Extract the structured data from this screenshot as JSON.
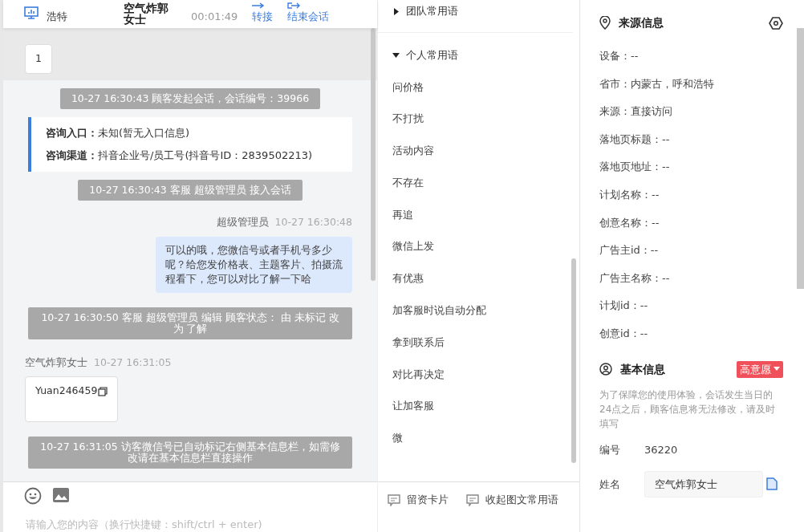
{
  "chat_header": {
    "location": "浩特",
    "customer_name": "空气炸郭女士",
    "duration": "00:01:49",
    "actions": [
      {
        "kind": "transfer",
        "label": "转接"
      },
      {
        "kind": "end",
        "label": "结束会话"
      }
    ]
  },
  "messages": [
    {
      "kind": "customer",
      "text": "1",
      "highlighted": true,
      "copyable": false
    },
    {
      "kind": "system",
      "text": "10-27 16:30:43 顾客发起会话，会话编号：39966"
    },
    {
      "kind": "entry",
      "lines": [
        {
          "label": "咨询入口：",
          "value": "未知(暂无入口信息)"
        },
        {
          "label": "咨询渠道：",
          "value": "抖音企业号/员工号(抖音号ID：2839502213)"
        }
      ]
    },
    {
      "kind": "system",
      "text": "10-27 16:30:43 客服 超级管理员 接入会话"
    },
    {
      "kind": "agent",
      "sender": "超级管理员",
      "time": "10-27 16:30:48",
      "text": "可以的哦，您微信号或者手机号多少呢？给您发价格表、主题客片、拍摄流程看下，您可以对比了解一下哈"
    },
    {
      "kind": "system",
      "text": "10-27 16:30:50 客服 超级管理员 编辑 顾客状态： 由 未标记 改为 了解"
    },
    {
      "kind": "customer",
      "sender": "空气炸郭女士",
      "time": "10-27 16:31:05",
      "text": "Yuan246459",
      "highlighted": false,
      "copyable": true
    },
    {
      "kind": "system",
      "text": "10-27 16:31:05 访客微信号已自动标记右侧基本信息栏，如需修改请在基本信息栏直接操作"
    }
  ],
  "composer": {
    "placeholder": "请输入您的内容（换行快捷键：shift/ctrl + enter)",
    "tools": [
      {
        "label": "留资卡片"
      },
      {
        "label": "收起图文常用语"
      }
    ]
  },
  "phrases": {
    "groups": [
      {
        "title": "团队常用语",
        "expanded": false
      },
      {
        "title": "个人常用语",
        "expanded": true,
        "items": [
          "问价格",
          "不打扰",
          "活动内容",
          "不存在",
          "再追",
          "微信上发",
          "有优惠",
          "加客服时说自动分配",
          "拿到联系后",
          "对比再决定",
          "让加客服",
          "微"
        ]
      }
    ]
  },
  "source_info": {
    "title": "来源信息",
    "fields": [
      "设备：--",
      "省市：内蒙古，呼和浩特",
      "来源：直接访问",
      "落地页标题：--",
      "落地页地址：--",
      "计划名称：--",
      "创意名称：--",
      "广告主id：--",
      "广告主名称：--",
      "计划id：--",
      "创意id：--"
    ]
  },
  "basic_info": {
    "title": "基本信息",
    "intent": {
      "label": "高意愿",
      "color": "#f0505a"
    },
    "note": "为了保障您的使用体验，会话发生当日的24点之后，顾客信息将无法修改，请及时填写",
    "id_label": "编号",
    "id_value": "36220",
    "name_label": "姓名",
    "name_value": "空气炸郭女士"
  }
}
